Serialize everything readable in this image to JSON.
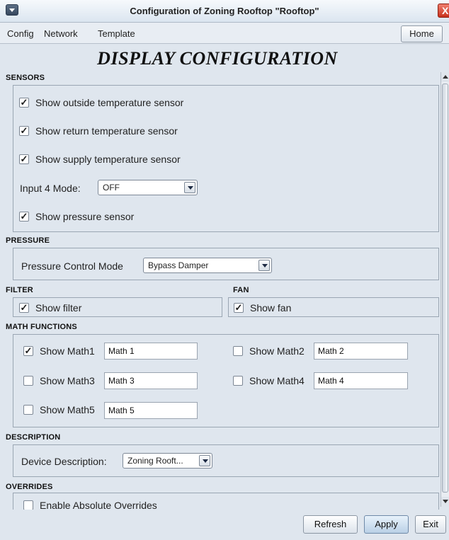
{
  "window": {
    "title": "Configuration of Zoning Rooftop \"Rooftop\"",
    "close_glyph": "X"
  },
  "menu": {
    "items": [
      "Config",
      "Network",
      "Template"
    ],
    "home_label": "Home"
  },
  "heading": "DISPLAY CONFIGURATION",
  "sensors": {
    "label": "SENSORS",
    "outside": {
      "label": "Show outside temperature sensor",
      "checked": true
    },
    "return": {
      "label": "Show return temperature sensor",
      "checked": true
    },
    "supply": {
      "label": "Show supply temperature sensor",
      "checked": true
    },
    "input4": {
      "label": "Input 4 Mode:",
      "value": "OFF"
    },
    "pressure_sensor": {
      "label": "Show pressure sensor",
      "checked": true
    }
  },
  "pressure": {
    "label": "PRESSURE",
    "mode_label": "Pressure Control Mode",
    "mode_value": "Bypass Damper"
  },
  "filter": {
    "label": "FILTER",
    "show_label": "Show filter",
    "checked": true
  },
  "fan": {
    "label": "FAN",
    "show_label": "Show fan",
    "checked": true
  },
  "math": {
    "label": "MATH FUNCTIONS",
    "items": [
      {
        "label": "Show Math1",
        "value": "Math 1",
        "checked": true
      },
      {
        "label": "Show Math2",
        "value": "Math 2",
        "checked": false
      },
      {
        "label": "Show Math3",
        "value": "Math 3",
        "checked": false
      },
      {
        "label": "Show Math4",
        "value": "Math 4",
        "checked": false
      },
      {
        "label": "Show Math5",
        "value": "Math 5",
        "checked": false
      }
    ]
  },
  "description": {
    "label": "DESCRIPTION",
    "device_label": "Device Description:",
    "device_value": "Zoning Rooft..."
  },
  "overrides": {
    "label": "OVERRIDES",
    "absolute": {
      "label": "Enable Absolute Overrides",
      "checked": false
    }
  },
  "buttons": {
    "refresh": "Refresh",
    "apply": "Apply",
    "exit": "Exit"
  },
  "colors": {
    "accent": "#b9d0e6",
    "close": "#c8321d",
    "background": "#dfe6ee"
  }
}
